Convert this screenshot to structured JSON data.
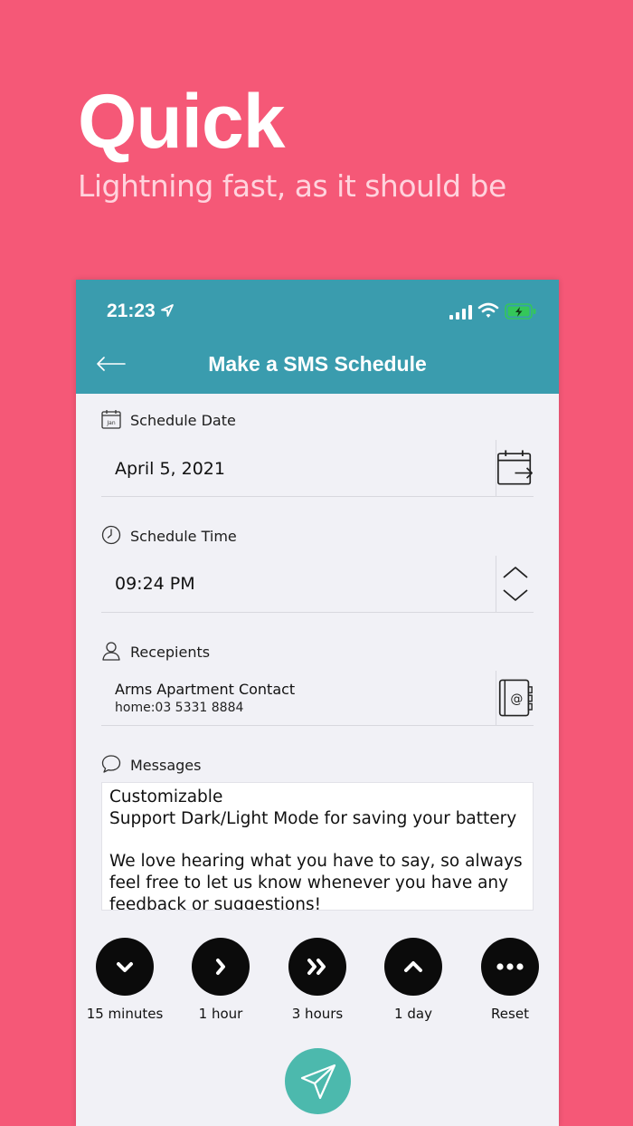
{
  "promo": {
    "headline": "Quick",
    "subline": "Lightning fast, as it should be"
  },
  "status_bar": {
    "time": "21:23"
  },
  "nav": {
    "title": "Make a SMS Schedule",
    "back_icon": "arrow-left-icon"
  },
  "schedule_date": {
    "label": "Schedule Date",
    "value": "April 5, 2021",
    "label_icon": "calendar-icon",
    "label_icon_text": "Jan",
    "button_icon": "calendar-arrow-icon"
  },
  "schedule_time": {
    "label": "Schedule Time",
    "value": "09:24 PM",
    "label_icon": "clock-icon",
    "button_icon": "chevron-up-down-icon"
  },
  "recipients": {
    "label": "Recepients",
    "name": "Arms Apartment Contact",
    "phone": "home:03 5331 8884",
    "label_icon": "person-icon",
    "button_icon": "address-book-icon"
  },
  "messages": {
    "label": "Messages",
    "label_icon": "speech-bubble-icon",
    "text": "Customizable\nSupport Dark/Light Mode for saving your battery\n\nWe love hearing what you have to say, so always feel free to let us know whenever you have any feedback or suggestions!"
  },
  "quick_actions": [
    {
      "label": "15 minutes",
      "icon": "chevron-down-icon"
    },
    {
      "label": "1 hour",
      "icon": "chevron-right-icon"
    },
    {
      "label": "3 hours",
      "icon": "double-chevron-right-icon"
    },
    {
      "label": "1 day",
      "icon": "chevron-up-icon"
    },
    {
      "label": "Reset",
      "icon": "ellipsis-icon"
    }
  ],
  "send": {
    "icon": "paper-plane-icon"
  },
  "colors": {
    "background": "#f55877",
    "header": "#3a9cae",
    "send_button": "#4cb9ad",
    "battery": "#34c759"
  }
}
